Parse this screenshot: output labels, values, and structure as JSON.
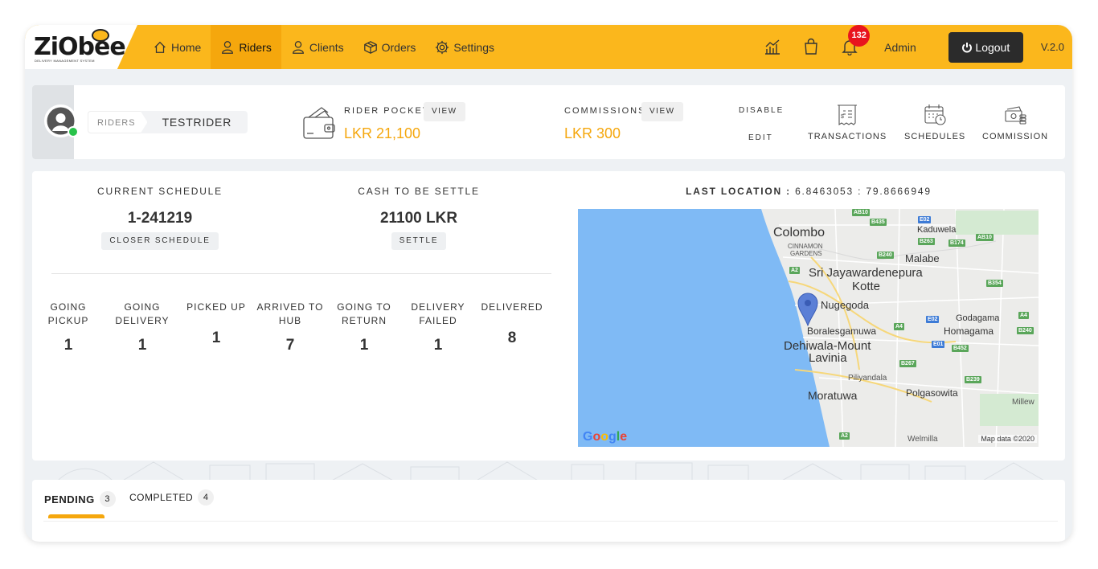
{
  "brand": {
    "name": "ZiObee",
    "tagline": "DELIVERY MANAGEMENT SYSTEM"
  },
  "nav": [
    {
      "label": "Home",
      "icon": "home-icon"
    },
    {
      "label": "Riders",
      "icon": "user-icon",
      "active": true
    },
    {
      "label": "Clients",
      "icon": "user-icon"
    },
    {
      "label": "Orders",
      "icon": "box-icon"
    },
    {
      "label": "Settings",
      "icon": "gear-icon"
    }
  ],
  "header": {
    "notification_count": "132",
    "user": "Admin",
    "logout_label": "Logout",
    "version": "V.2.0"
  },
  "rider": {
    "breadcrumb_section": "RIDERS",
    "name": "TESTRIDER",
    "pocket_label": "RIDER POCKET",
    "pocket_view": "VIEW",
    "pocket_value": "LKR 21,100",
    "commissions_label": "COMMISSIONS",
    "commissions_view": "VIEW",
    "commissions_value": "LKR 300",
    "disable_label": "DISABLE",
    "edit_label": "EDIT",
    "tools": [
      {
        "label": "TRANSACTIONS",
        "icon": "receipt-icon"
      },
      {
        "label": "SCHEDULES",
        "icon": "calendar-clock-icon"
      },
      {
        "label": "COMMISSION",
        "icon": "cash-icon"
      }
    ]
  },
  "schedule": {
    "current_label": "CURRENT SCHEDULE",
    "current_value": "1-241219",
    "closer_button": "CLOSER SCHEDULE",
    "cash_label": "CASH TO BE SETTLE",
    "cash_value": "21100 LKR",
    "settle_button": "SETTLE"
  },
  "statuses": [
    {
      "label": "GOING PICKUP",
      "value": "1"
    },
    {
      "label": "GOING DELIVERY",
      "value": "1"
    },
    {
      "label": "PICKED UP",
      "value": "1"
    },
    {
      "label": "ARRIVED TO HUB",
      "value": "7"
    },
    {
      "label": "GOING TO RETURN",
      "value": "1"
    },
    {
      "label": "DELIVERY FAILED",
      "value": "1"
    },
    {
      "label": "DELIVERED",
      "value": "8"
    }
  ],
  "location": {
    "title": "LAST LOCATION :",
    "coords": "6.8463053 : 79.8666949",
    "map_labels": {
      "colombo": "Colombo",
      "kaduwela": "Kaduwela",
      "cinnamon": "CINNAMON",
      "gardens": "GARDENS",
      "malabe": "Malabe",
      "sri_jaya": "Sri Jayawardenepura",
      "kotte": "Kotte",
      "nugegoda": "Nugegoda",
      "godagama": "Godagama",
      "boralesgamuwa": "Boralesgamuwa",
      "homagama": "Homagama",
      "dehiwala": "Dehiwala-Mount",
      "lavinia": "Lavinia",
      "piliyandala": "Piliyandala",
      "moratuwa": "Moratuwa",
      "polgasowita": "Polgasowita",
      "millew": "Millew",
      "welmilla": "Welmilla"
    },
    "roads": [
      "AB10",
      "B435",
      "E02",
      "B263",
      "B174",
      "AB10",
      "B240",
      "A2",
      "B354",
      "A4",
      "E02",
      "A4",
      "B240",
      "E01",
      "B452",
      "B267",
      "B239",
      "A2"
    ],
    "google": "Google",
    "map_data": "Map data ©2020"
  },
  "tabs": [
    {
      "label": "PENDING",
      "count": "3",
      "active": true
    },
    {
      "label": "COMPLETED",
      "count": "4"
    }
  ],
  "colors": {
    "accent": "#fbb71c",
    "accent_dark": "#f5a70d",
    "dark": "#2b2b2b",
    "badge": "#e8141e",
    "online": "#28c24a"
  }
}
